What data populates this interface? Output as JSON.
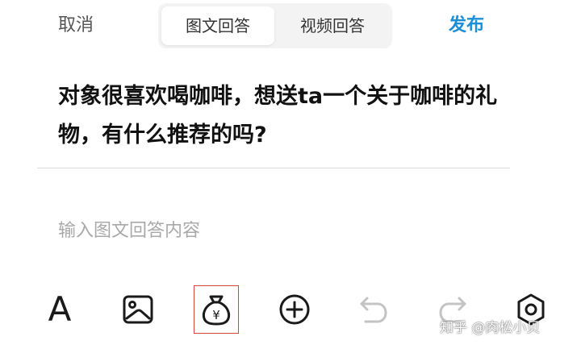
{
  "header": {
    "cancel_label": "取消",
    "tabs": [
      {
        "label": "图文回答",
        "active": true
      },
      {
        "label": "视频回答",
        "active": false
      }
    ],
    "publish_label": "发布",
    "publish_color": "#1a8fd8"
  },
  "question": {
    "text": "对象很喜欢喝咖啡，想送ta一个关于咖啡的礼物，有什么推荐的吗?"
  },
  "answer": {
    "value": "",
    "placeholder": "输入图文回答内容"
  },
  "toolbar": {
    "items": [
      {
        "icon": "font-icon",
        "glyph": "A"
      },
      {
        "icon": "image-icon"
      },
      {
        "icon": "reward-bag-icon",
        "glyph": "¥",
        "highlight_color": "#d4453a"
      },
      {
        "icon": "plus-circle-icon"
      },
      {
        "icon": "undo-icon",
        "enabled": false
      },
      {
        "icon": "redo-icon",
        "enabled": false
      },
      {
        "icon": "settings-icon"
      }
    ]
  },
  "watermark": {
    "text": "知乎 @肉松小贝"
  }
}
